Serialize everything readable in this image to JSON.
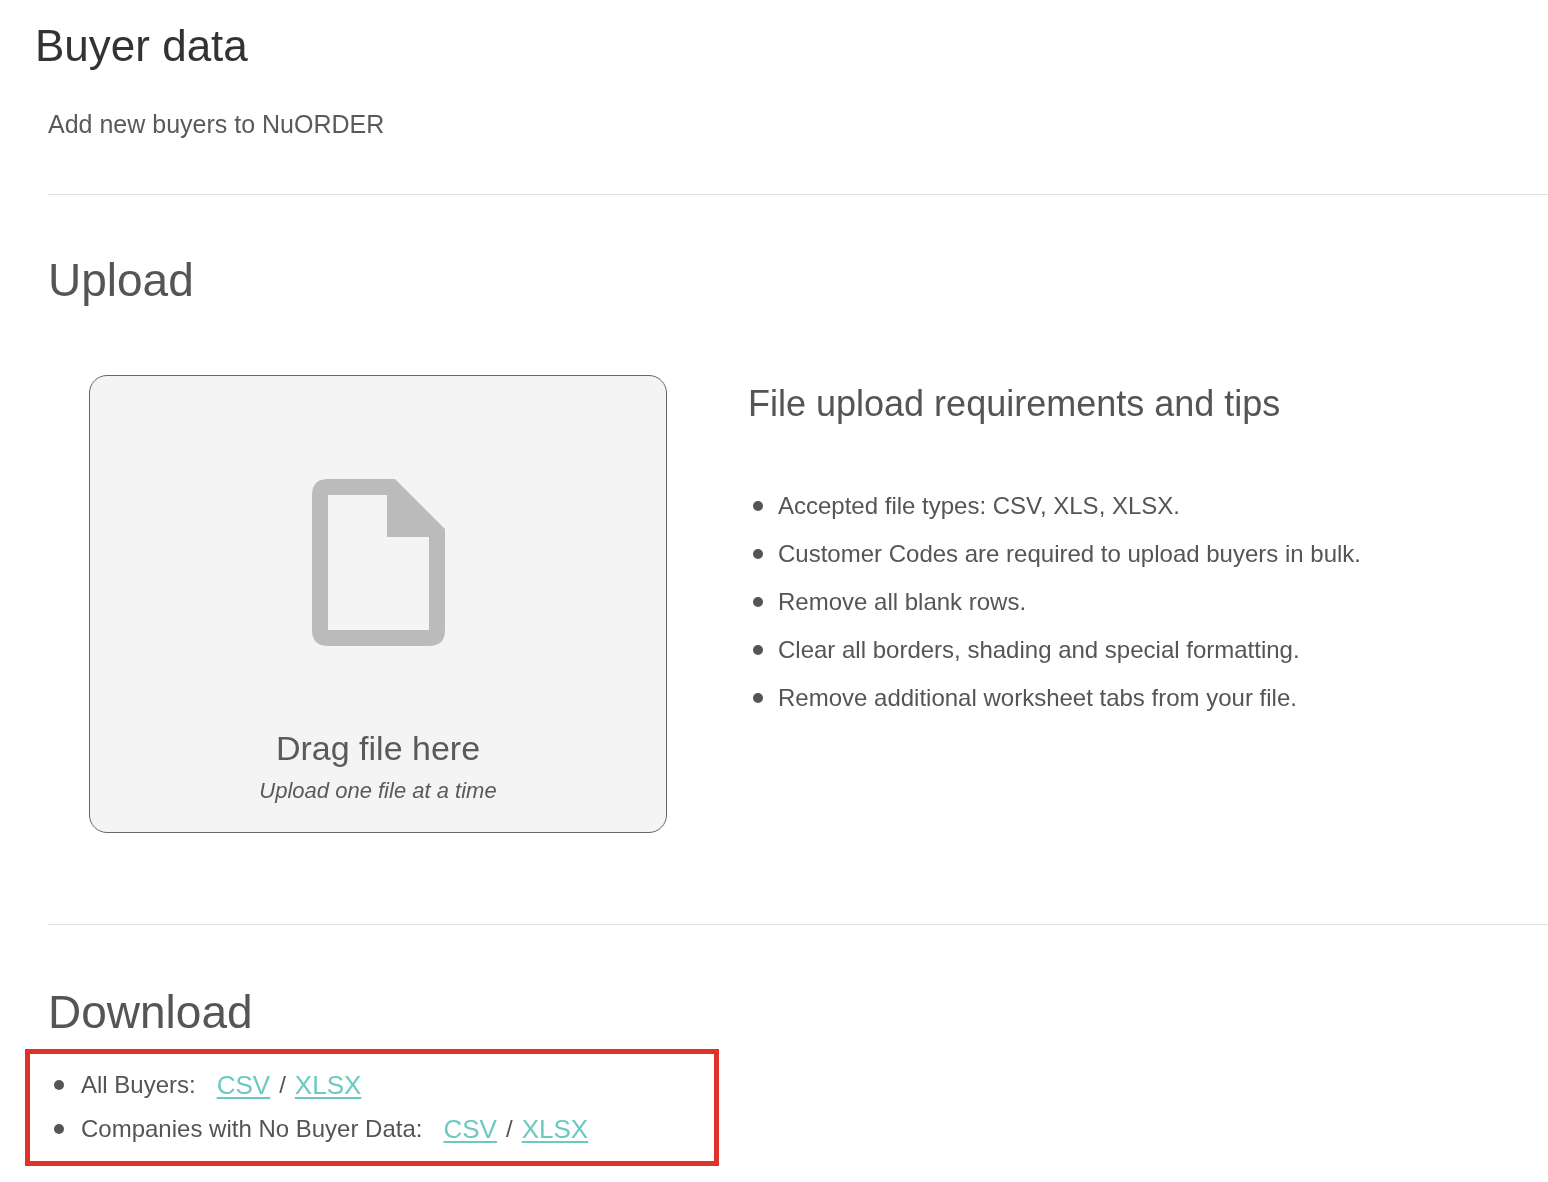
{
  "page": {
    "title": "Buyer data",
    "subtitle": "Add new buyers to NuORDER"
  },
  "upload": {
    "heading": "Upload",
    "dropzone": {
      "title": "Drag file here",
      "hint": "Upload one file at a time"
    },
    "tips": {
      "heading": "File upload requirements and tips",
      "items": [
        "Accepted file types: CSV, XLS, XLSX.",
        "Customer Codes are required to upload buyers in bulk.",
        "Remove all blank rows.",
        "Clear all borders, shading and special formatting.",
        "Remove additional worksheet tabs from your file."
      ]
    }
  },
  "download": {
    "heading": "Download",
    "highlighted": true,
    "items": [
      {
        "label": "All Buyers:",
        "links": [
          "CSV",
          "XLSX"
        ],
        "separator": "/"
      },
      {
        "label": "Companies with No Buyer Data:",
        "links": [
          "CSV",
          "XLSX"
        ],
        "separator": "/"
      }
    ]
  }
}
